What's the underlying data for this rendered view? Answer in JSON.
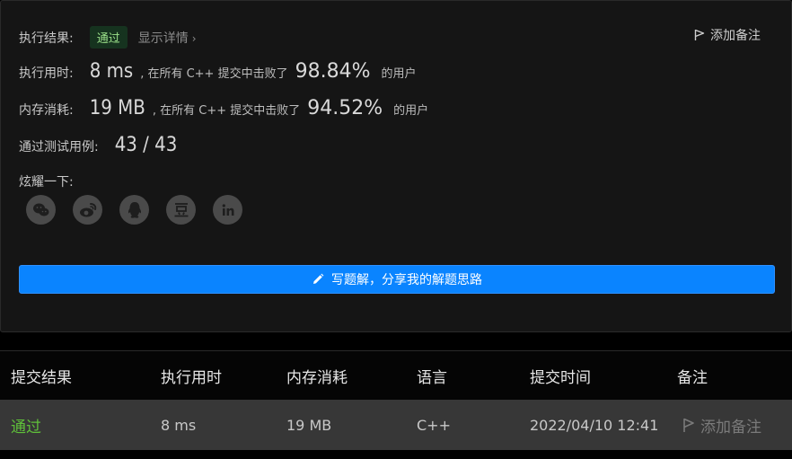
{
  "result": {
    "label": "执行结果:",
    "status": "通过",
    "details_link": "显示详情",
    "details_chevron": "›",
    "add_note": "添加备注"
  },
  "runtime": {
    "label": "执行用时:",
    "value": "8 ms",
    "text_before": ", 在所有 C++ 提交中击败了",
    "percent": "98.84%",
    "text_after": "的用户"
  },
  "memory": {
    "label": "内存消耗:",
    "value": "19 MB",
    "text_before": ", 在所有 C++ 提交中击败了",
    "percent": "94.52%",
    "text_after": "的用户"
  },
  "tests": {
    "label": "通过测试用例:",
    "value": "43 / 43"
  },
  "share": {
    "label": "炫耀一下:",
    "icons": [
      "wechat-icon",
      "weibo-icon",
      "qq-icon",
      "douban-icon",
      "linkedin-icon"
    ]
  },
  "write_solution": {
    "label": "写题解，分享我的解题思路"
  },
  "table": {
    "headers": {
      "result": "提交结果",
      "time": "执行用时",
      "memory": "内存消耗",
      "language": "语言",
      "submitted_at": "提交时间",
      "note": "备注"
    },
    "row": {
      "result": "通过",
      "time": "8 ms",
      "memory": "19 MB",
      "language": "C++",
      "submitted_at": "2022/04/10 12:41",
      "note": "添加备注"
    }
  },
  "colors": {
    "accept_green": "#5fbf3a",
    "button_blue": "#0a84ff"
  }
}
